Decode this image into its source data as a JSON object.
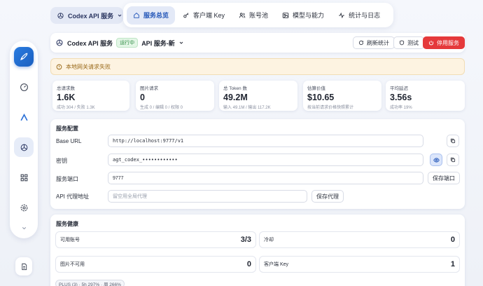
{
  "service_selector": {
    "label": "Codex API 服务"
  },
  "nav": {
    "tabs": [
      {
        "label": "服务总览",
        "icon": "home-icon",
        "active": true
      },
      {
        "label": "客户端 Key",
        "icon": "key-icon",
        "active": false
      },
      {
        "label": "账号池",
        "icon": "users-icon",
        "active": false
      },
      {
        "label": "模型与能力",
        "icon": "image-icon",
        "active": false
      },
      {
        "label": "统计与日志",
        "icon": "activity-icon",
        "active": false
      }
    ]
  },
  "header": {
    "service_name": "Codex API 服务",
    "status": "运行中",
    "instance": "API 服务-新",
    "refresh": "刷新统计",
    "test": "测试",
    "stop": "停用服务"
  },
  "alert": {
    "text": "本地网关请求失败"
  },
  "stats": [
    {
      "label": "总请求数",
      "value": "1.6K",
      "sub": "成功 304 / 失败 1.3K"
    },
    {
      "label": "图片请求",
      "value": "0",
      "sub": "生成 0 / 编辑 0 / 权限 0"
    },
    {
      "label": "总 Token 数",
      "value": "49.2M",
      "sub": "输入 49.1M / 输出 117.2K"
    },
    {
      "label": "估算价值",
      "value": "$10.65",
      "sub": "按当前请求价格快照累计"
    },
    {
      "label": "平均延迟",
      "value": "3.56s",
      "sub": "成功率 19%"
    }
  ],
  "config": {
    "title": "服务配置",
    "base_url_label": "Base URL",
    "base_url": "http://localhost:9777/v1",
    "secret_label": "密钥",
    "secret": "agt_codex_••••••••••••",
    "port_label": "服务端口",
    "port": "9777",
    "save_port": "保存端口",
    "proxy_label": "API 代理地址",
    "proxy_placeholder": "留空用全局代理",
    "save_proxy": "保存代理"
  },
  "health": {
    "title": "服务健康",
    "items": [
      {
        "label": "可用账号",
        "value": "3/3"
      },
      {
        "label": "冷却",
        "value": "0"
      },
      {
        "label": "图片不可用",
        "value": "0"
      },
      {
        "label": "客户端 Key",
        "value": "1"
      }
    ],
    "pill": "PLUS (3) · 5h 297% · 周 266%"
  },
  "colors": {
    "accent": "#2356b8",
    "danger": "#e5393b",
    "success": "#2e8b43",
    "warning_bg": "#fdf3e1"
  }
}
